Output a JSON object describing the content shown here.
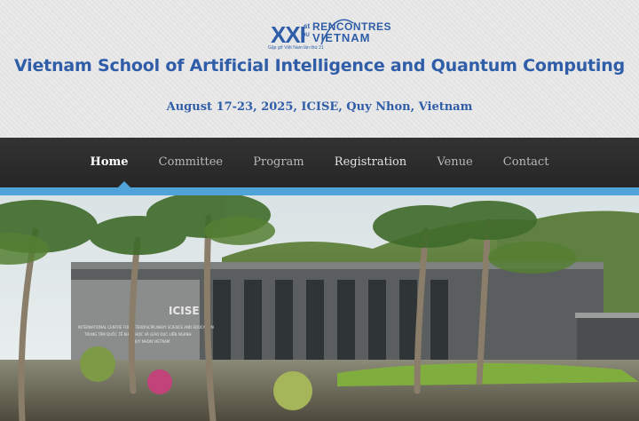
{
  "logo": {
    "number": "XXI",
    "superscript": "st",
    "word1": "RENCONTRES",
    "du": "DU",
    "word2": "VIETNAM",
    "tagline": "Gặp gỡ Việt Nam lần thứ 21"
  },
  "header": {
    "title": "Vietnam School of Artificial Intelligence and Quantum Computing",
    "dates": "August 17-23, 2025, ICISE, Quy Nhon, Vietnam"
  },
  "nav": {
    "items": [
      {
        "label": "Home",
        "state": "active"
      },
      {
        "label": "Committee",
        "state": "normal"
      },
      {
        "label": "Program",
        "state": "normal"
      },
      {
        "label": "Registration",
        "state": "highlight"
      },
      {
        "label": "Venue",
        "state": "normal"
      },
      {
        "label": "Contact",
        "state": "normal"
      }
    ]
  },
  "photo": {
    "sign": "ICISE",
    "plaque_lines": [
      "INTERNATIONAL CENTRE FOR INTERDISCIPLINARY SCIENCE AND EDUCATION",
      "TRUNG TÂM QUỐC TẾ KHOA HỌC VÀ GIÁO DỤC LIÊN NGÀNH",
      "QUY NHON VIETNAM"
    ]
  },
  "colors": {
    "brand": "#2f5da8",
    "nav_bg": "#2b2b2b",
    "accent_bar": "#4fa3d8"
  }
}
